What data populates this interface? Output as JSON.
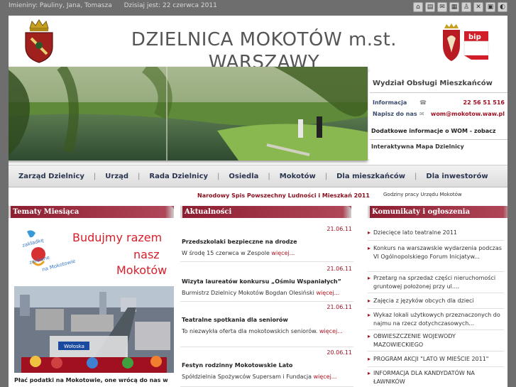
{
  "topbar": {
    "nameday": "Imieniny: Pauliny, Jana, Tomasza",
    "today": "Dzisiaj jest: 22 czerwca 2011",
    "icons": [
      "home-icon",
      "document-icon",
      "mail-icon",
      "print-icon",
      "person-icon",
      "tools-icon",
      "sitemap-icon",
      "contrast-icon"
    ]
  },
  "header": {
    "title": "DZIELNICA MOKOTÓW m.st. WARSZAWY",
    "bip_label": "bip"
  },
  "wom": {
    "title": "Wydział Obsługi Mieszkańców",
    "info_label": "Informacja",
    "info_value": "22 56 51 516",
    "mail_label": "Napisz do nas",
    "mail_value": "wom@mokotow.waw.pl",
    "more": "Dodatkowe informacje o WOM - zobacz",
    "map": "Interaktywna Mapa Dzielnicy"
  },
  "nav": {
    "items": [
      "Zarząd Dzielnicy",
      "Urząd",
      "Rada Dzielnicy",
      "Osiedla",
      "Mokotów",
      "Dla mieszkańców",
      "Dla inwestorów"
    ]
  },
  "notice": "Narodowy Spis Powszechny Ludności i Mieszkań 2011",
  "hours": "Godziny pracy Urzędu Mokotów",
  "columns": {
    "left": "Tematy Miesiąca",
    "middle": "Aktualności",
    "right": "Komunikaty i ogłoszenia"
  },
  "campaign": {
    "headline_1": "Budujmy razem",
    "headline_2": "nasz",
    "headline_3": "Mokotów",
    "badge_1": "zakładkę",
    "badge_2": "zarówne",
    "badge_3": "na Mokotowie"
  },
  "city": {
    "street_sign": "Wołoska"
  },
  "left_caption": "Płać podatki na Mokotowie, one wrócą do nas w",
  "news": [
    {
      "date": "21.06.11",
      "title": "Przedszkolaki bezpieczne na drodze",
      "text": "W środę 15 czerwca w Zespole",
      "more": "więcej..."
    },
    {
      "date": "21.06.11",
      "title": "Wizyta laureatów konkursu „Ośmiu Wspaniałych”",
      "text": "Burmistrz Dzielnicy Mokotów Bogdan Olesiński",
      "more": "więcej..."
    },
    {
      "date": "21.06.11",
      "title": "Teatralne spotkania dla seniorów",
      "text": "To niezwykła oferta dla mokotowskich seniorów.",
      "more": "więcej..."
    },
    {
      "date": "20.06.11",
      "title": "Festyn rodzinny Mokotowskie Lato",
      "text": "Spółdzielnia Spożywców Supersam i Fundacja",
      "more": "więcej..."
    }
  ],
  "announcements": [
    "Dziecięce lato teatralne 2011",
    "Konkurs na warszawskie wydarzenia podczas VI Ogólnopolskiego Forum Inicjatyw...",
    "Przetarg na sprzedaż części nieruchomości gruntowej położonej przy ul....",
    "Zajęcia z języków obcych dla dzieci",
    "Wykaz lokali użytkowych przeznaczonych do najmu na rzecz dotychczasowych...",
    "OBWIESZCZENIE WOJEWODY MAZOWIECKIEGO",
    "PROGRAM AKCJI \"LATO W MIEŚCIE 2011\"",
    "INFORMACJA DLA KANDYDATÓW NA ŁAWNIKÓW"
  ],
  "colors": {
    "accent": "#8c1e30",
    "link_red": "#a01020",
    "nav_text": "#2a3550",
    "page_bg": "#6e6e6e"
  }
}
